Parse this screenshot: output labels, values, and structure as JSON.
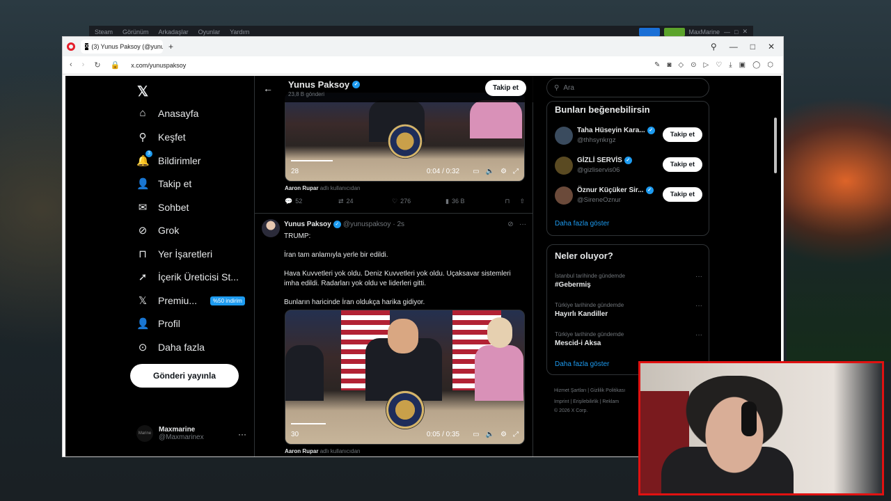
{
  "steam": {
    "menus": [
      "Steam",
      "Görünüm",
      "Arkadaşlar",
      "Oyunlar",
      "Yardım"
    ],
    "user": "MaxMarine"
  },
  "browser": {
    "tab_title": "(3) Yunus Paksoy (@yunus",
    "url": "x.com/yunuspaksoy"
  },
  "nav": {
    "items": [
      {
        "label": "Anasayfa",
        "icon": "home-icon",
        "glyph": "⌂"
      },
      {
        "label": "Keşfet",
        "icon": "search-icon",
        "glyph": "⚲"
      },
      {
        "label": "Bildirimler",
        "icon": "bell-icon",
        "glyph": "🔔",
        "badge": "3"
      },
      {
        "label": "Takip et",
        "icon": "person-add-icon",
        "glyph": "👤"
      },
      {
        "label": "Sohbet",
        "icon": "mail-icon",
        "glyph": "✉"
      },
      {
        "label": "Grok",
        "icon": "grok-icon",
        "glyph": "⊘"
      },
      {
        "label": "Yer İşaretleri",
        "icon": "bookmark-icon",
        "glyph": "⊓"
      },
      {
        "label": "İçerik Üreticisi St...",
        "icon": "rocket-icon",
        "glyph": "➚"
      },
      {
        "label": "Premiu...",
        "icon": "x-premium-icon",
        "glyph": "𝕏",
        "promo": "%50 indirim"
      },
      {
        "label": "Profil",
        "icon": "profile-icon",
        "glyph": "👤"
      },
      {
        "label": "Daha fazla",
        "icon": "more-circle-icon",
        "glyph": "⊙"
      }
    ],
    "post_button": "Gönderi yayınla",
    "account": {
      "name": "Maxmarine",
      "handle": "@Maxmarinex",
      "avatar_text": "Marine"
    }
  },
  "profile_header": {
    "name": "Yunus Paksoy",
    "count": "23,8 B gönderi",
    "follow": "Takip et"
  },
  "first_post": {
    "video_time": "0:04 / 0:32",
    "view_overlay": "28",
    "via_name": "Aaron Rupar",
    "via_suffix": "adlı kullanıcıdan",
    "replies": "52",
    "reposts": "24",
    "likes": "276",
    "views": "36 B"
  },
  "second_post": {
    "name": "Yunus Paksoy",
    "handle": "@yunuspaksoy",
    "time": "· 2s",
    "text": "TRUMP:\n\nİran tam anlamıyla yerle bir edildi.\n\nHava Kuvvetleri yok oldu. Deniz Kuvvetleri yok oldu. Uçaksavar sistemleri imha edildi. Radarları yok oldu ve liderleri gitti.\n\nBunların haricinde İran oldukça harika gidiyor.",
    "video_time": "0:05 / 0:35",
    "view_overlay": "30",
    "via_name": "Aaron Rupar",
    "via_suffix": "adlı kullanıcıdan"
  },
  "sidebar": {
    "search_placeholder": "Ara",
    "wtf_title": "Bunları beğenebilirsin",
    "suggestions": [
      {
        "name": "Taha Hüseyin Kara...",
        "handle": "@thhsynkrgz",
        "button": "Takip et",
        "avatar_color": "#3a4b5e"
      },
      {
        "name": "GİZLİ SERVİS",
        "handle": "@gizliservis06",
        "button": "Takip et",
        "avatar_color": "#5a4a22"
      },
      {
        "name": "Öznur Küçüker Sir...",
        "handle": "@SireneOznur",
        "button": "Takip et",
        "avatar_color": "#6b4a3a"
      }
    ],
    "show_more": "Daha fazla göster",
    "trends_title": "Neler oluyor?",
    "trends": [
      {
        "context": "İstanbul tarihinde gündemde",
        "topic": "#Gebermiş"
      },
      {
        "context": "Türkiye tarihinde gündemde",
        "topic": "Hayırlı Kandiller"
      },
      {
        "context": "Türkiye tarihinde gündemde",
        "topic": "Mescid-i Aksa"
      }
    ],
    "trends_more": "Daha fazla göster",
    "footer": {
      "links1": "Hizmet Şartları  |   Gizlilik Politikası",
      "links2": "Imprint  |   Erişilebilirlik  |   Reklam",
      "copyright": "© 2026 X Corp."
    }
  },
  "colors": {
    "accent": "#1d9bf0",
    "cam_border": "#e11111"
  }
}
